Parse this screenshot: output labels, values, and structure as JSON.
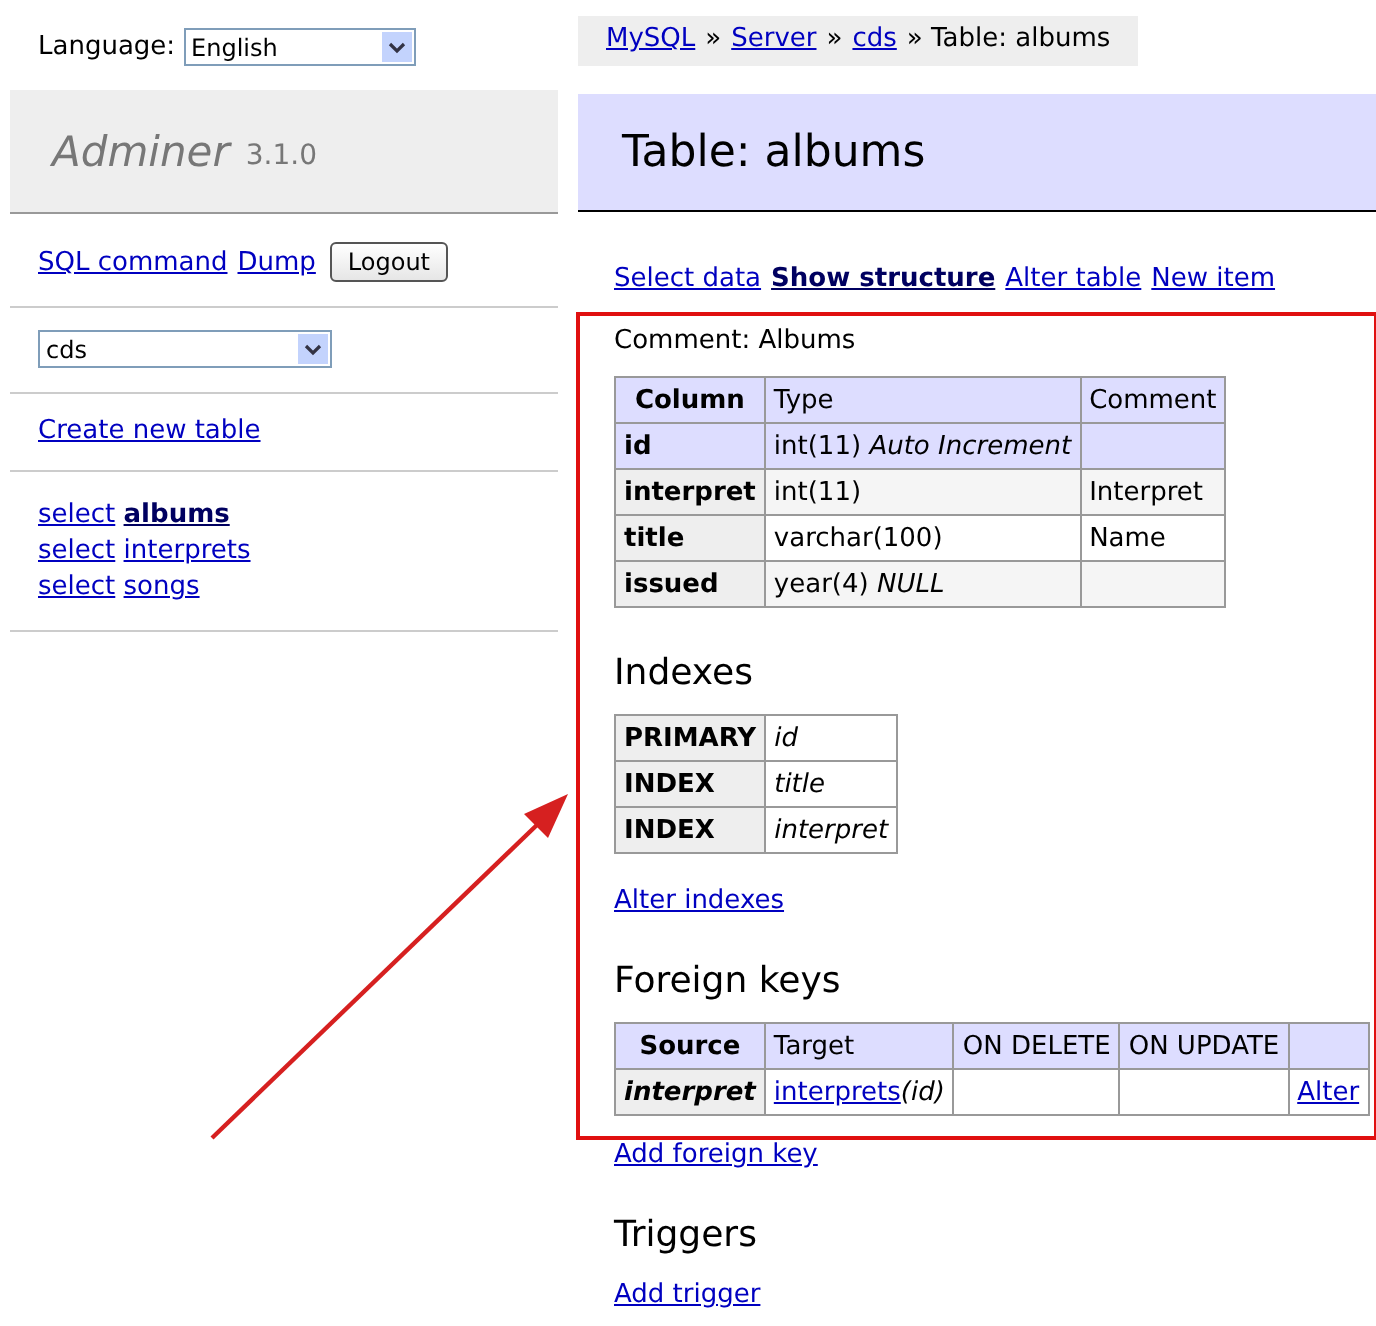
{
  "language": {
    "label": "Language:",
    "value": "English"
  },
  "logo": {
    "name": "Adminer",
    "version": "3.1.0"
  },
  "sidebar": {
    "links": [
      "SQL command",
      "Dump"
    ],
    "logout": "Logout",
    "database": "cds",
    "create_link": "Create new table",
    "tables": [
      {
        "action": "select",
        "name": "albums",
        "selected": true
      },
      {
        "action": "select",
        "name": "interprets",
        "selected": false
      },
      {
        "action": "select",
        "name": "songs",
        "selected": false
      }
    ]
  },
  "breadcrumb": [
    {
      "text": "MySQL",
      "link": true
    },
    {
      "text": "»",
      "link": false
    },
    {
      "text": "Server",
      "link": true
    },
    {
      "text": "»",
      "link": false
    },
    {
      "text": "cds",
      "link": true
    },
    {
      "text": "» Table: albums",
      "link": false
    }
  ],
  "title": "Table: albums",
  "tabs": [
    {
      "label": "Select data",
      "selected": false
    },
    {
      "label": "Show structure",
      "selected": true
    },
    {
      "label": "Alter table",
      "selected": false
    },
    {
      "label": "New item",
      "selected": false
    }
  ],
  "comment": "Comment: Albums",
  "structure": {
    "columns": [
      "Column",
      "Type",
      "Comment"
    ],
    "rows": [
      {
        "name": "id",
        "type": "int(11) *Auto Increment*",
        "comment": "",
        "primary": true
      },
      {
        "name": "interpret",
        "type": "int(11)",
        "comment": "Interpret",
        "primary": false
      },
      {
        "name": "title",
        "type": "varchar(100)",
        "comment": "Name",
        "primary": false
      },
      {
        "name": "issued",
        "type": "year(4) *NULL*",
        "comment": "",
        "primary": false
      }
    ]
  },
  "indexes": {
    "heading": "Indexes",
    "rows": [
      {
        "type": "PRIMARY",
        "columns": "id"
      },
      {
        "type": "INDEX",
        "columns": "title"
      },
      {
        "type": "INDEX",
        "columns": "interpret"
      }
    ],
    "alter_link": "Alter indexes"
  },
  "foreign_keys": {
    "heading": "Foreign keys",
    "columns": [
      "Source",
      "Target",
      "ON DELETE",
      "ON UPDATE"
    ],
    "rows": [
      {
        "source": "interpret",
        "target_table": "interprets",
        "target_columns": "(id)",
        "on_delete": "",
        "on_update": "",
        "action": "Alter"
      }
    ],
    "add_link": "Add foreign key"
  },
  "triggers": {
    "heading": "Triggers",
    "add_link": "Add trigger"
  }
}
